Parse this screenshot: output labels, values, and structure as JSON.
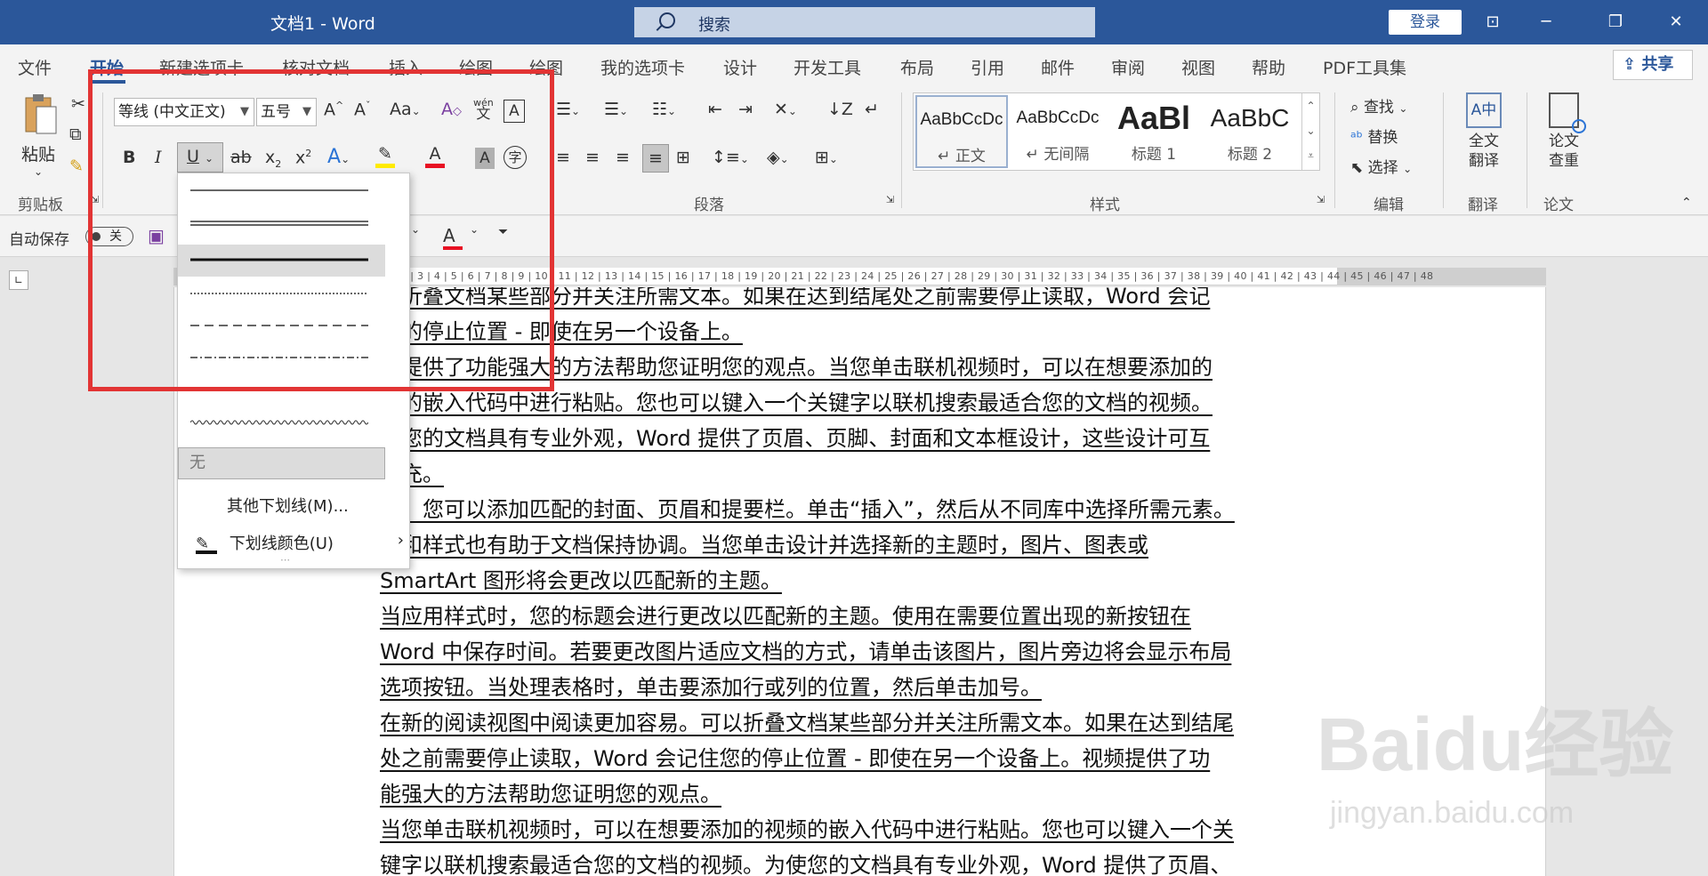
{
  "window": {
    "title": "文档1  -  Word"
  },
  "search": {
    "label": "搜索"
  },
  "account": {
    "login_label": "登录"
  },
  "tabs": [
    "文件",
    "开始",
    "新建选项卡",
    "核对文档",
    "插入",
    "绘图",
    "绘图",
    "我的选项卡",
    "设计",
    "开发工具",
    "布局",
    "引用",
    "邮件",
    "审阅",
    "视图",
    "帮助",
    "PDF工具集"
  ],
  "share": {
    "label": "共享"
  },
  "clipboard": {
    "paste_label": "粘贴",
    "group_label": "剪贴板"
  },
  "font": {
    "name": "等线 (中文正文)",
    "size": "五号",
    "phonetic_small": "wén",
    "phonetic_big": "文"
  },
  "paragraph": {
    "group_label": "段落"
  },
  "styles": {
    "group_label": "样式",
    "items": [
      {
        "preview": "AaBbCcDc",
        "name": "↵ 正文"
      },
      {
        "preview": "AaBbCcDc",
        "name": "↵ 无间隔"
      },
      {
        "preview": "AaBl",
        "name": "标题 1"
      },
      {
        "preview": "AaBbC",
        "name": "标题 2"
      }
    ]
  },
  "editing": {
    "find": "查找",
    "replace": "替换",
    "select": "选择",
    "group_label": "编辑"
  },
  "translate": {
    "label1": "全文",
    "label2": "翻译",
    "group_label": "翻译"
  },
  "paper": {
    "label1": "论文",
    "label2": "查重",
    "group_label": "论文"
  },
  "qat": {
    "autosave": "自动保存",
    "toggle": "关"
  },
  "underline_menu": {
    "none_label": "无",
    "more_label": "其他下划线(M)...",
    "color_label": "下划线颜色(U)"
  },
  "ruler": {
    "ticks": "40 | 1 | 2 | 3 | 4 | 5 | 6 | 7 | 8 | 9 | 10 | 11 | 12 | 13 | 14 | 15 | 16 | 17 | 18 | 19 | 20 | 21 | 22 | 23 | 24 | 25 | 26 | 27 | 28 | 29 | 30 | 31 | 32 | 33 | 34 | 35 | 36 | 37 | 38 | 39 |  40 | 41 | 42 | 43 | 44 | 45 | 46 | 47 | 48"
  },
  "document": {
    "lines": [
      "以折叠文档某些部分并关注所需文本。如果在达到结尾处之前需要停止读取，Word 会记",
      "您的停止位置 - 即使在另一个设备上。",
      "频提供了功能强大的方法帮助您证明您的观点。当您单击联机视频时，可以在想要添加的",
      "频的嵌入代码中进行粘贴。您也可以键入一个关键字以联机搜索最适合您的文档的视频。",
      "使您的文档具有专业外观，Word 提供了页眉、页脚、封面和文本框设计，这些设计可互",
      "补充。",
      "如，您可以添加匹配的封面、页眉和提要栏。单击“插入”，然后从不同库中选择所需元素。",
      "题和样式也有助于文档保持协调。当您单击设计并选择新的主题时，图片、图表或",
      "SmartArt 图形将会更改以匹配新的主题。",
      "当应用样式时，您的标题会进行更改以匹配新的主题。使用在需要位置出现的新按钮在",
      "Word 中保存时间。若要更改图片适应文档的方式，请单击该图片，图片旁边将会显示布局",
      "选项按钮。当处理表格时，单击要添加行或列的位置，然后单击加号。",
      "在新的阅读视图中阅读更加容易。可以折叠文档某些部分并关注所需文本。如果在达到结尾",
      "处之前需要停止读取，Word 会记住您的停止位置 - 即使在另一个设备上。视频提供了功",
      "能强大的方法帮助您证明您的观点。",
      "当您单击联机视频时，可以在想要添加的视频的嵌入代码中进行粘贴。您也可以键入一个关",
      "键字以联机搜索最适合您的文档的视频。为使您的文档具有专业外观，Word 提供了页眉、"
    ]
  },
  "watermark": {
    "brand": "Baidu经验",
    "url": "jingyan.baidu.com"
  },
  "colors": {
    "accent": "#2b579a",
    "highlight_box": "#e23434",
    "font_color_bar": "#e81123",
    "highlighter_bar": "#ffeb00"
  }
}
